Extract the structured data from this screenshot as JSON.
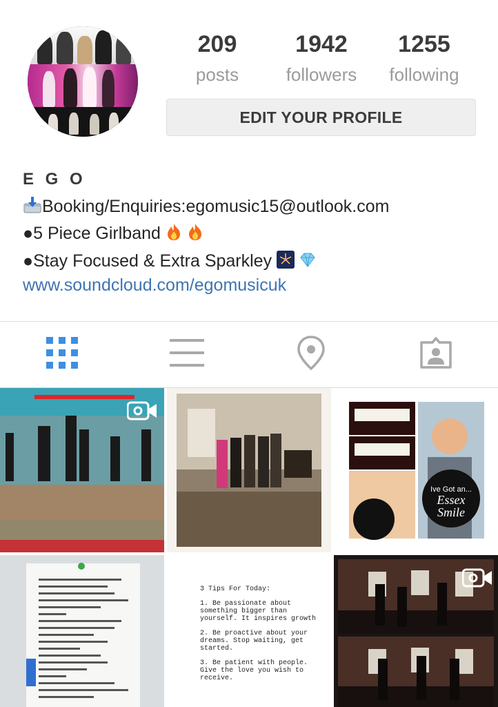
{
  "profile": {
    "stats": {
      "posts_count": "209",
      "posts_label": "posts",
      "followers_count": "1942",
      "followers_label": "followers",
      "following_count": "1255",
      "following_label": "following"
    },
    "edit_button_label": "EDIT YOUR PROFILE"
  },
  "bio": {
    "name": "E G O",
    "line1": "Booking/Enquiries:egomusic15@outlook.com",
    "line2": "●5 Piece Girlband",
    "line3": "●Stay Focused & Extra Sparkley",
    "link": "www.soundcloud.com/egomusicuk"
  },
  "tabs": [
    {
      "icon": "grid-icon",
      "active": true
    },
    {
      "icon": "list-icon",
      "active": false
    },
    {
      "icon": "location-pin-icon",
      "active": false
    },
    {
      "icon": "tagged-person-icon",
      "active": false
    }
  ],
  "posts": {
    "tile3_caption_line1": "Ive Got an...",
    "tile3_caption_line2": "Essex",
    "tile3_caption_line3": "Smile",
    "tile5_heading": "3 Tips For Today:",
    "tile5_tip1": "1. Be passionate about something bigger than yourself. It inspires growth",
    "tile5_tip2": "2. Be proactive about your dreams. Stop waiting, get started.",
    "tile5_tip3": "3. Be patient with people. Give the love you wish to receive."
  },
  "colors": {
    "accent_blue": "#3f8fe0",
    "link_blue": "#3f74b3",
    "text_dark": "#3b3b3b",
    "text_muted": "#9b9b9b",
    "icon_gray": "#a9a9a9"
  }
}
